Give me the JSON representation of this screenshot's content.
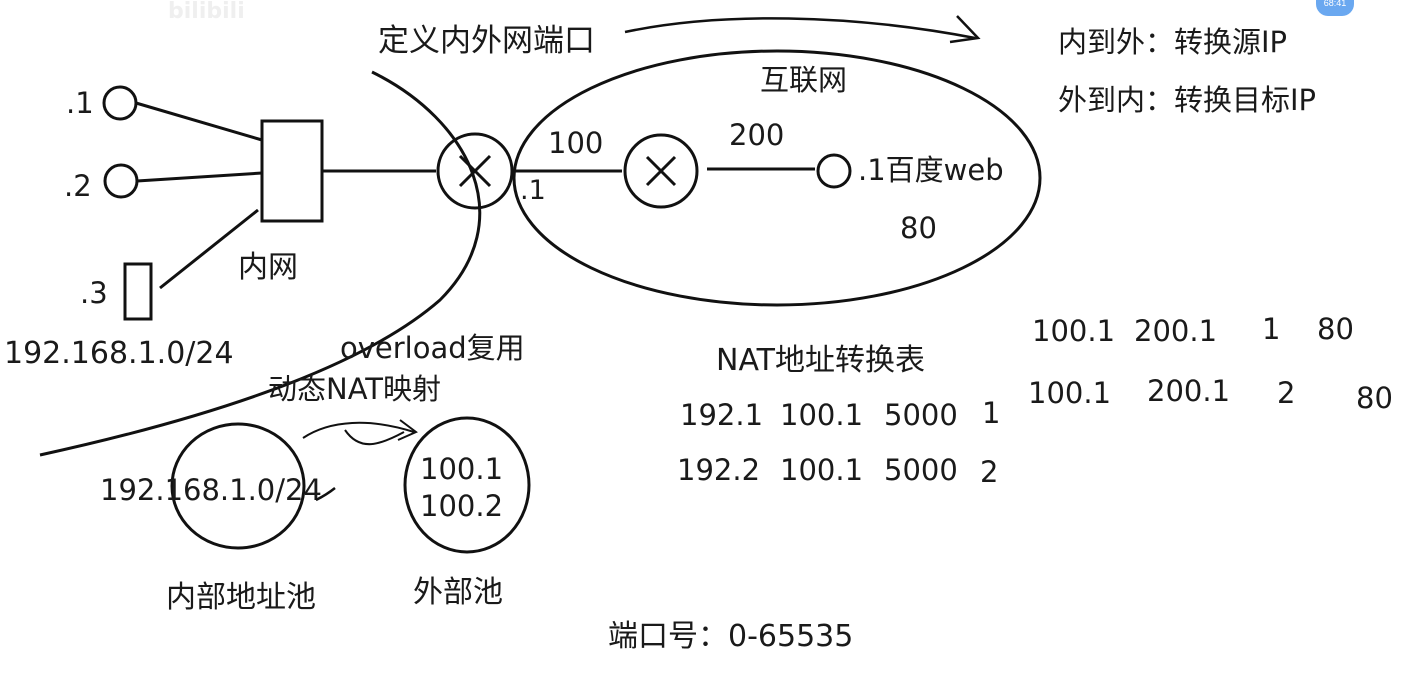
{
  "watermark": "bilibili",
  "badge": "68:41",
  "labels": {
    "define_ports": "定义内外网端口",
    "internet": "互联网",
    "intranet": "内网",
    "host1": ".1",
    "host2": ".2",
    "host3": ".3",
    "subnet": "192.168.1.0/24",
    "router_inside_ip": ".1",
    "link_100": "100",
    "link_200": "200",
    "server": ".1百度web",
    "server_port": "80",
    "overload": "overload复用",
    "dynamic_nat": "动态NAT映射",
    "pool_subnet": "192.168.1.0/24",
    "pool_ext_1": "100.1",
    "pool_ext_2": "100.2",
    "internal_pool": "内部地址池",
    "external_pool": "外部池",
    "nat_table_title": "NAT地址转换表",
    "port_range": "端口号：0-65535",
    "rule_in_out": "内到外：转换源IP",
    "rule_out_in": "外到内：转换目标IP"
  },
  "nat_table_rows": [
    [
      "192.1",
      "100.1",
      "5000",
      "1"
    ],
    [
      "192.2",
      "100.1",
      "5000",
      "2"
    ]
  ],
  "outside_table_rows": [
    [
      "100.1",
      "200.1",
      "1",
      "80"
    ],
    [
      "100.1",
      "200.1",
      "2",
      "80"
    ]
  ]
}
